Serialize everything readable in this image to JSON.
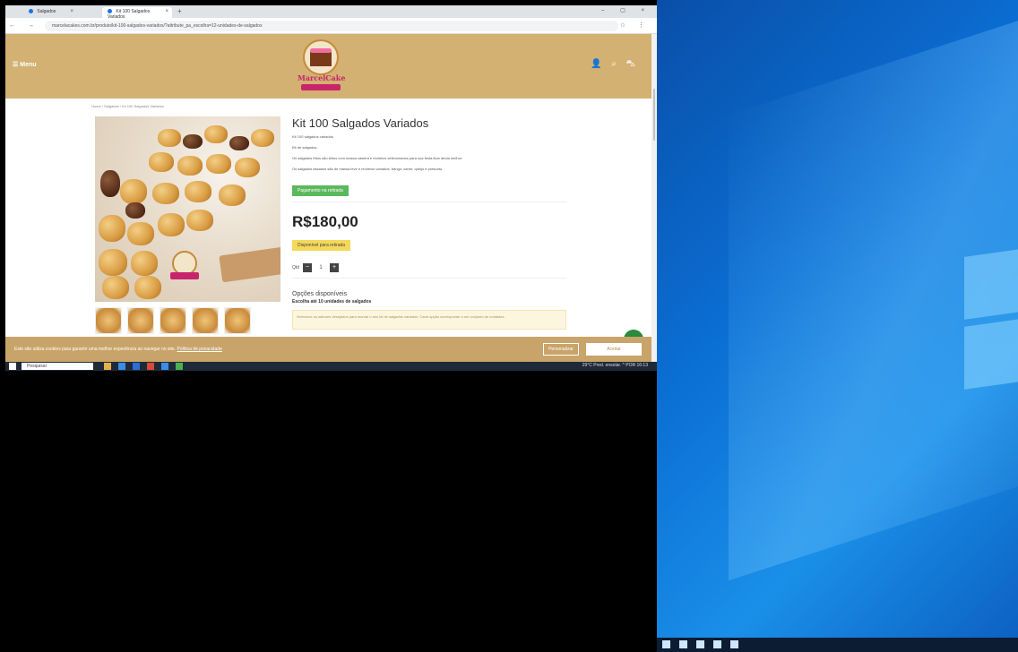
{
  "browser": {
    "tabs": [
      {
        "label": "Salgados"
      },
      {
        "label": "Kit 100 Salgados Variados"
      }
    ],
    "url": "marcelacakes.com.br/produto/kit-100-salgados-variados/?attribute_pa_escolha=12-unidades-de-salgados"
  },
  "site": {
    "menu_label": "Menu",
    "logo_text": "MarcelCake",
    "breadcrumb": "Home / Salgados / Kit 100 Salgados Variados"
  },
  "product": {
    "title": "Kit 100 Salgados Variados",
    "desc_lines": [
      "Kit 100 salgados variados.",
      "Kit de salgados.",
      "Os salgados fritos são feitos com massa caseira e recheios selecionados para sua festa ficar ainda melhor.",
      "Os salgados assados são de massa leve e recheios variados: frango, carne, queijo e presunto."
    ],
    "stock_badge": "Pagamento na retirada",
    "price": "R$180,00",
    "delivery_badge": "Disponível para retirada",
    "qty_label": "Qtd",
    "qty_value": "1",
    "options_title": "Opções disponíveis",
    "options_sub": "Escolha até 10 unidades de salgados",
    "options_note": "Selecione os sabores desejados para montar o seu kit de salgados variados. Cada opção corresponde a um conjunto de unidades."
  },
  "cookie": {
    "text": "Este site utiliza cookies para garantir uma melhor experiência ao navegar no site.",
    "link": "Política de privacidade",
    "btn_reject": "Personalizar",
    "btn_accept": "Aceitar"
  },
  "taskbar": {
    "search_placeholder": "Pesquisar",
    "tray": "29°C Pred. ensolar.  ^  POR  16:13"
  },
  "colors": {
    "header": "#d2b173",
    "cookie_bar": "#c9a46a",
    "green_badge": "#5cb85c",
    "yellow_badge": "#f5d85a",
    "brand_pink": "#c8246b"
  }
}
